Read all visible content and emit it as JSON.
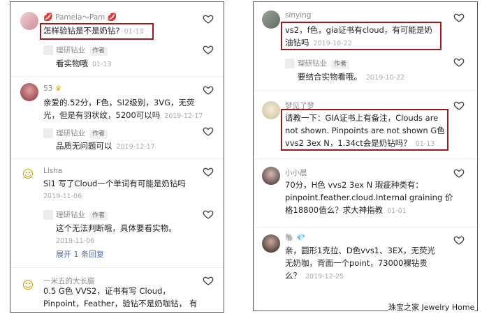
{
  "left": {
    "c1": {
      "name": "Pamela～Pam",
      "text": "怎样验钻是不是奶钻?",
      "time": "01-13",
      "reply": {
        "name": "理研钻业",
        "tag": "作者",
        "text": "看实物哦",
        "time": "01-13"
      }
    },
    "c2": {
      "name": "53",
      "line1": "亲爱的.52分，F色，SI2级别，3VG，无荧",
      "line2": "光，但是有羽状纹，5200可以吗",
      "time": "2019-12-17",
      "reply": {
        "name": "理研钻业",
        "tag": "作者",
        "text": "品质无问题可以",
        "time": "2019-12-17"
      }
    },
    "c3": {
      "name": "Lisha",
      "text": "Si1  写了Cloud一个单词有可能是奶钻吗",
      "date": "2019-11-06",
      "reply": {
        "name": "理研钻业",
        "tag": "作者",
        "text": "这个无法判断哦，具体要看实物。",
        "date": "2019-11-06"
      },
      "more": "展开 1 条回复"
    },
    "c4": {
      "name": "一米五的大长腿",
      "line1": "0.5 G色 VVS2，证书有写 Cloud，",
      "line2": "Pinpoint，Feather，验钻不是奶咖钻，  有"
    }
  },
  "right": {
    "c1": {
      "name": "sinying",
      "line1": "vs2，f色，gia证书有cloud，有可能是奶",
      "line2": "油钻吗",
      "time": "2019-10-22",
      "reply": {
        "name": "理研钻业",
        "tag": "作者",
        "text": "要结合实物看哦。",
        "time": "2019-10-22"
      }
    },
    "c2": {
      "name": "梦见了梦",
      "line1": "请教一下：GIA证书上有备注，Clouds are",
      "line2": "not shown. Pinpoints are not shown G色",
      "line3": "vvs2    3ex N，1.34ct会是奶钻吗？",
      "time": "01-13"
    },
    "c3": {
      "name": "小小晨",
      "line1": "70分，H色 vvs2  3ex N 瑕疵种类有：",
      "line2": "pinpoint.feather.cloud.Internal graining  价",
      "line3": "格18800值么？求大神指教",
      "time": "01-01"
    },
    "c4": {
      "name": "🐘 💎",
      "line1": "亲，圆形1克拉、D色vvs1、3EX，无荧光",
      "line2": "无奶咖，背面一个point，73000裸钻贵",
      "line3": "么？",
      "time": "2019-12-25"
    }
  },
  "watermark": "珠宝之家  Jewelry Home",
  "colors": {
    "highlight_box": "#9b1b1b",
    "link": "#4a6ea8",
    "meta": "#aaaaaa"
  }
}
